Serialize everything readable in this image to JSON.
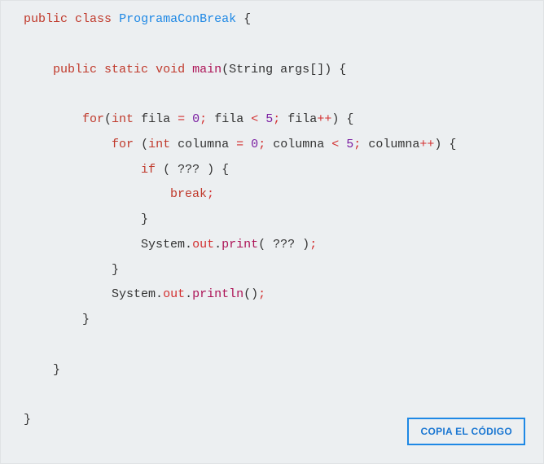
{
  "code": {
    "t_public": "public",
    "t_class": "class",
    "t_static": "static",
    "t_void": "void",
    "t_for": "for",
    "t_int": "int",
    "t_if": "if",
    "t_break": "break",
    "cls_name": "ProgramaConBreak",
    "fn_main": "main",
    "fn_print": "print",
    "fn_println": "println",
    "type_string": "String",
    "args": "args",
    "var_fila": "fila",
    "var_columna": "columna",
    "n0": "0",
    "n5": "5",
    "sys": "System",
    "out": "out",
    "q": "???",
    "lt": "<",
    "inc": "++",
    "eq": "=",
    "semi": ";",
    "dot": ".",
    "ob": "{",
    "cb": "}",
    "op": "(",
    "cp": ")",
    "obk": "[",
    "cbk": "]",
    "sp": " "
  },
  "button": {
    "copy_label": "COPIA EL CÓDIGO"
  }
}
